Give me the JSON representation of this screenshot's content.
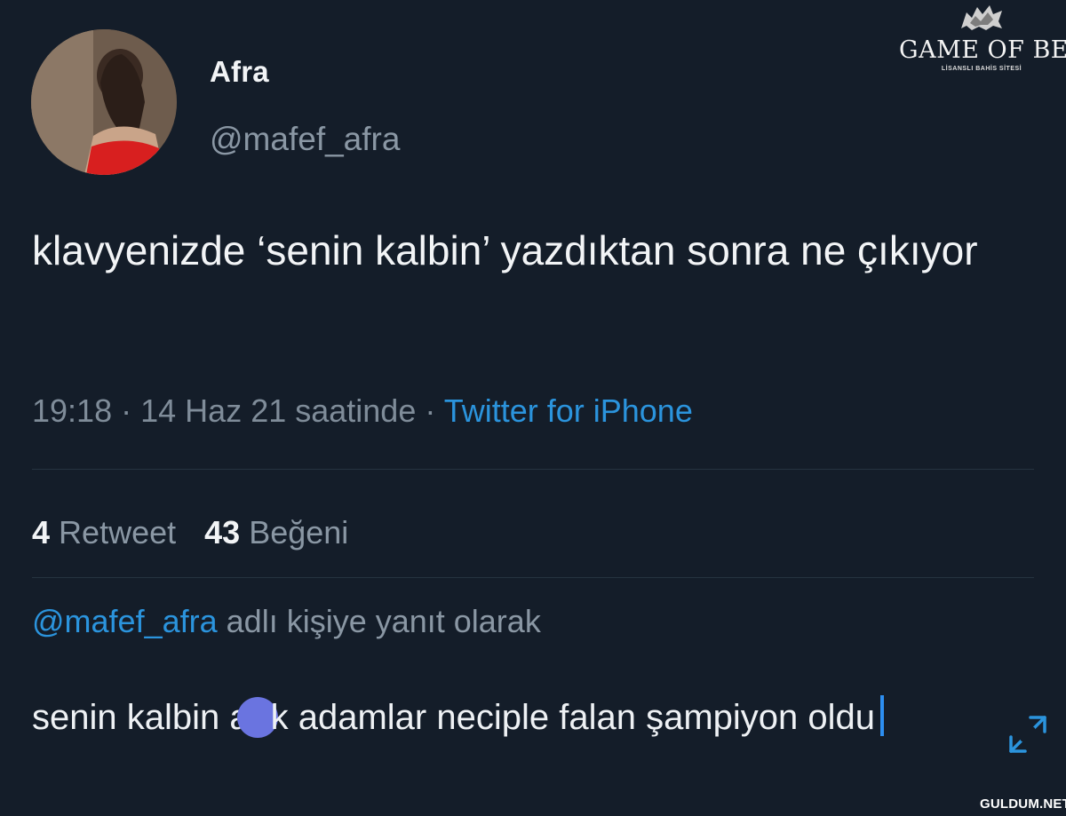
{
  "profile": {
    "display_name": "Afra",
    "handle": "@mafef_afra"
  },
  "tweet": {
    "text": "klavyenizde ‘senin kalbin’ yazdıktan sonra ne çıkıyor",
    "time": "19:18",
    "sep1": "·",
    "date": "14 Haz 21 saatinde",
    "sep2": "·",
    "source": "Twitter for iPhone"
  },
  "stats": {
    "retweets": "4",
    "retweets_label": "Retweet",
    "likes": "43",
    "likes_label": "Beğeni"
  },
  "reply": {
    "mention": "@mafef_afra",
    "suffix": "adlı kişiye yanıt olarak"
  },
  "compose": {
    "text_before": "senin kalbin a",
    "text_after": "k adamlar neciple falan şampiyon oldu"
  },
  "brand": {
    "name": "GAME OF BET",
    "tagline": "LİSANSLI BAHİS SİTESİ"
  },
  "watermark": {
    "text": "GULDUM.NET"
  },
  "colors": {
    "background": "#141d29",
    "link": "#2b94dd",
    "muted": "#8a97a4",
    "redaction": "#6a74e0"
  },
  "icons": {
    "expand": "expand-arrows-icon",
    "brand": "wolf-head-icon"
  }
}
